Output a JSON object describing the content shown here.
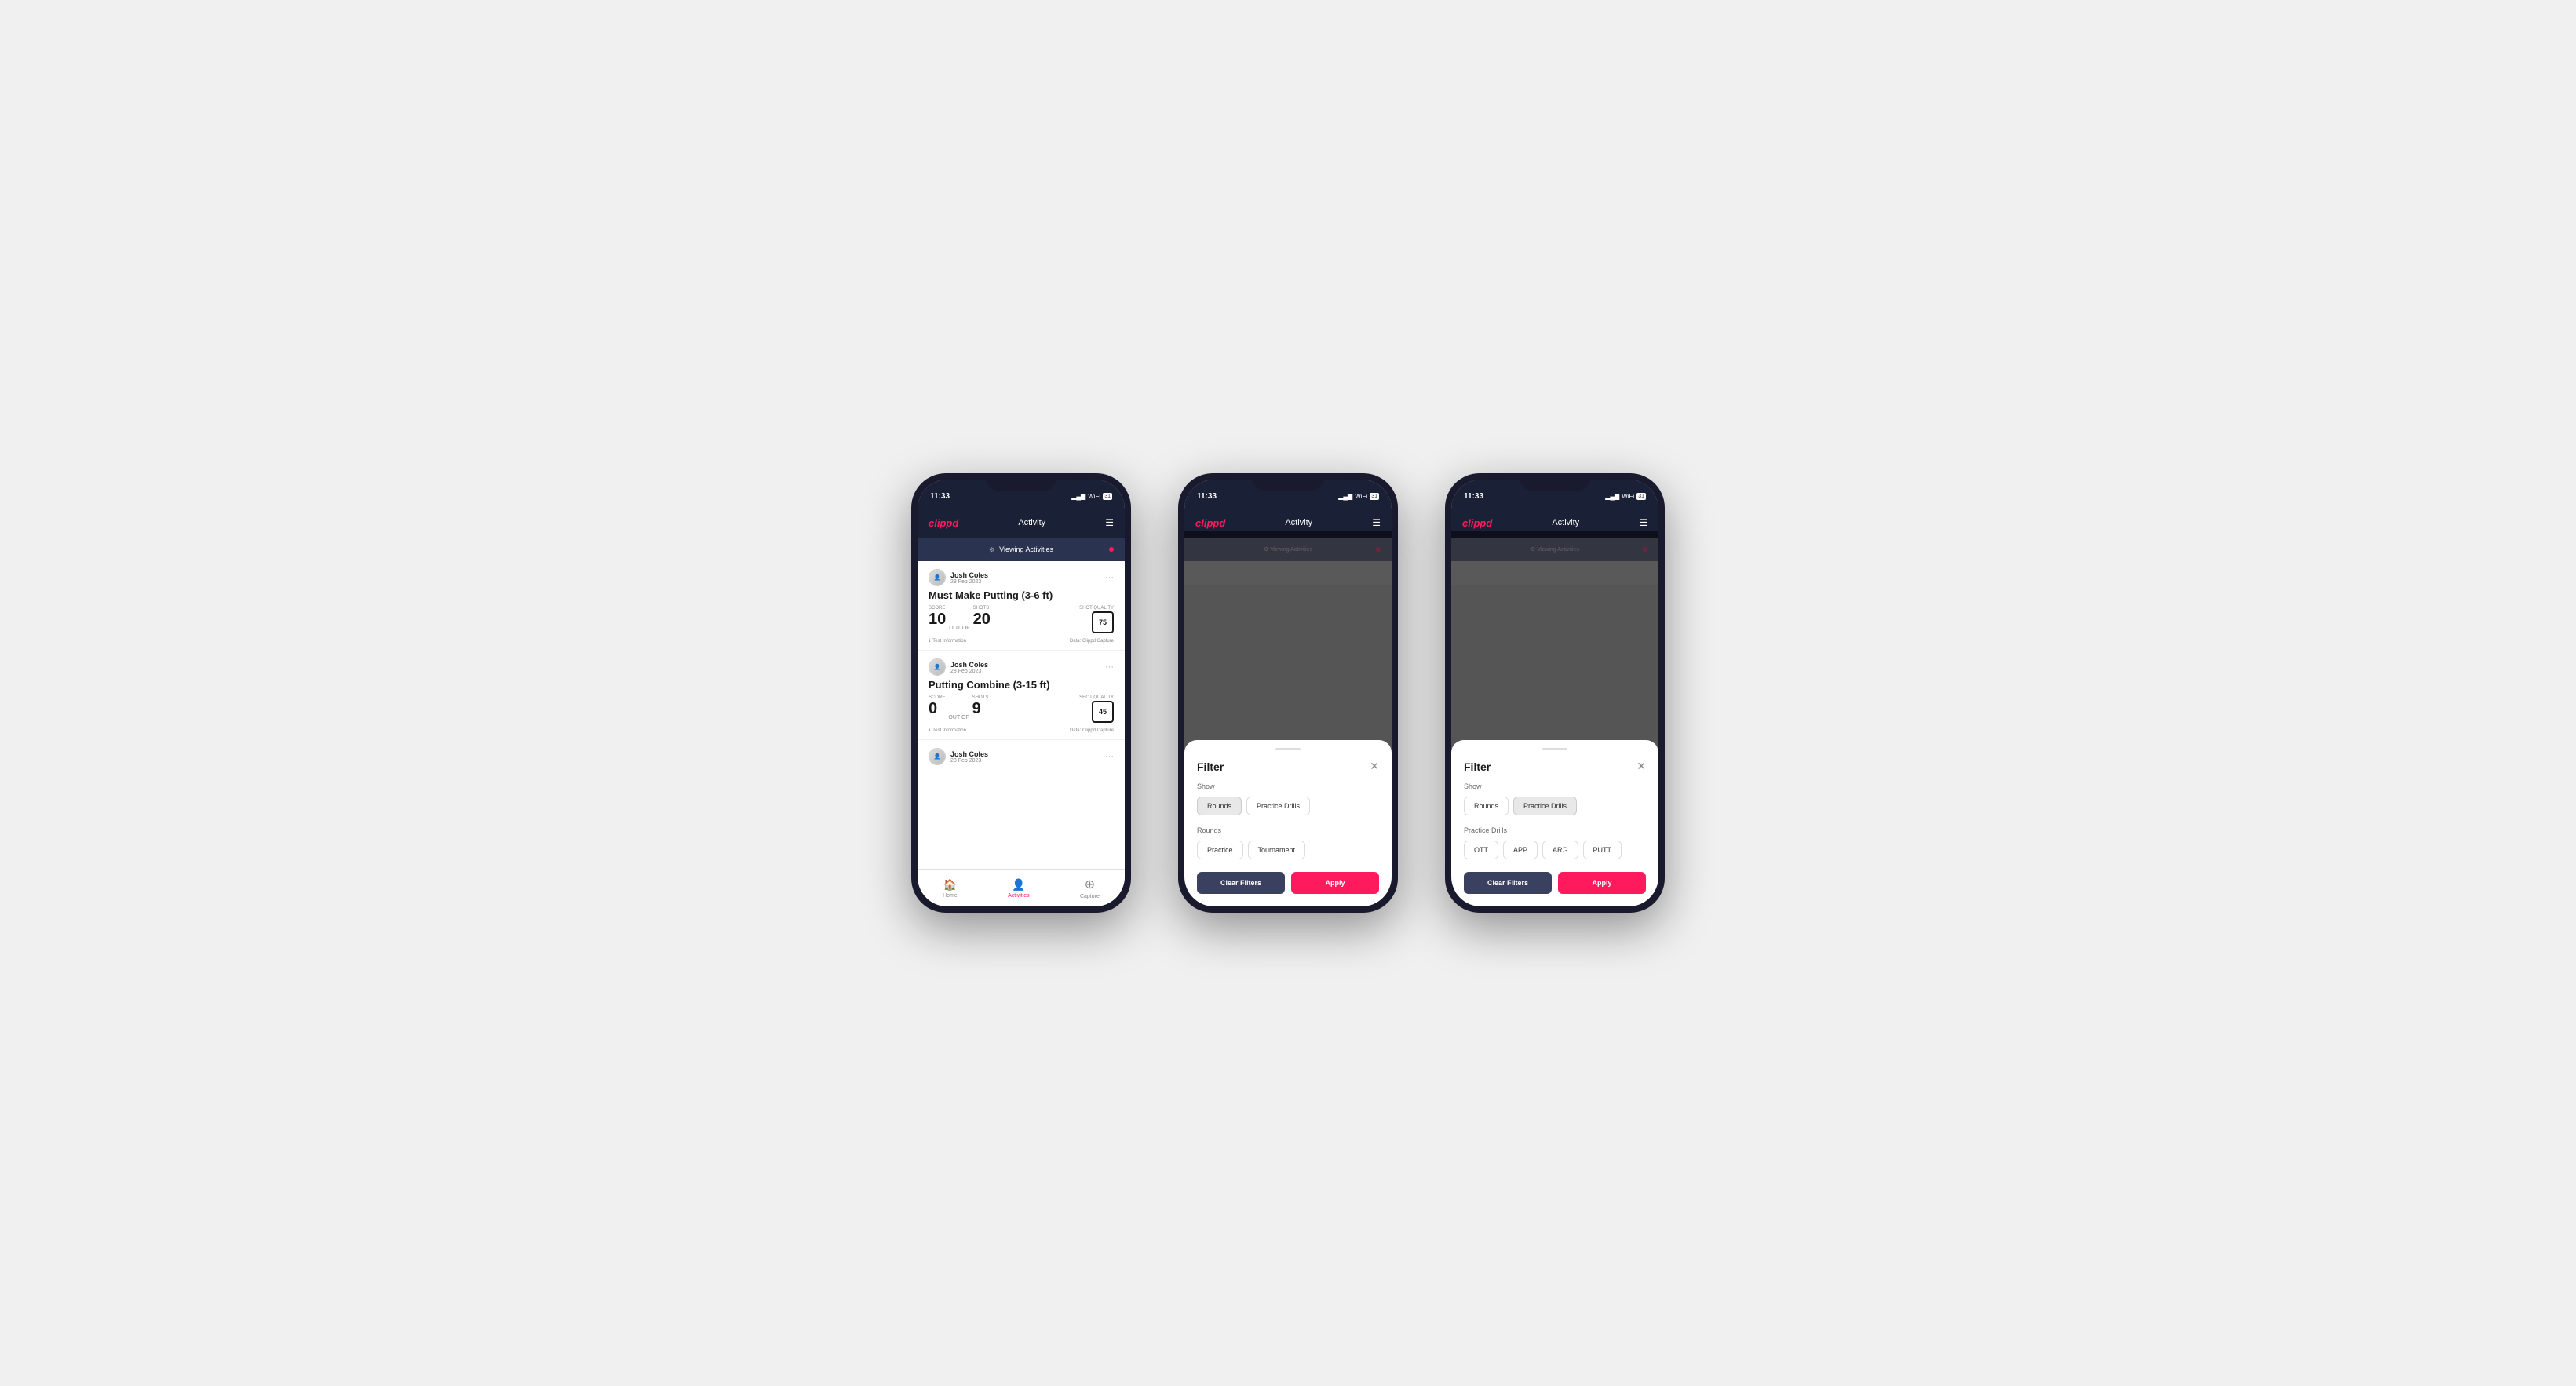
{
  "app": {
    "time": "11:33",
    "logo": "clippd",
    "header_title": "Activity",
    "viewing_bar_text": "Viewing Activities"
  },
  "phone1": {
    "cards": [
      {
        "user_name": "Josh Coles",
        "user_date": "28 Feb 2023",
        "title": "Must Make Putting (3-6 ft)",
        "score_label": "Score",
        "score": "10",
        "out_of_label": "OUT OF",
        "shots_label": "Shots",
        "shots": "20",
        "shot_quality_label": "Shot Quality",
        "shot_quality": "75",
        "info_text": "Test Information",
        "data_source": "Data: Clippd Capture"
      },
      {
        "user_name": "Josh Coles",
        "user_date": "28 Feb 2023",
        "title": "Putting Combine (3-15 ft)",
        "score_label": "Score",
        "score": "0",
        "out_of_label": "OUT OF",
        "shots_label": "Shots",
        "shots": "9",
        "shot_quality_label": "Shot Quality",
        "shot_quality": "45",
        "info_text": "Test Information",
        "data_source": "Data: Clippd Capture"
      },
      {
        "user_name": "Josh Coles",
        "user_date": "28 Feb 2023",
        "title": "",
        "score": "",
        "shots": "",
        "shot_quality": ""
      }
    ],
    "nav": [
      {
        "label": "Home",
        "icon": "🏠",
        "active": false
      },
      {
        "label": "Activities",
        "icon": "👤",
        "active": true
      },
      {
        "label": "Capture",
        "icon": "⊕",
        "active": false
      }
    ]
  },
  "phone2": {
    "filter": {
      "title": "Filter",
      "show_label": "Show",
      "rounds_label": "Rounds",
      "practice_drills_label": "Practice Drills",
      "rounds_section_label": "Rounds",
      "practice_btn": "Practice",
      "tournament_btn": "Tournament",
      "clear_filters_label": "Clear Filters",
      "apply_label": "Apply",
      "selected_tab": "Rounds"
    }
  },
  "phone3": {
    "filter": {
      "title": "Filter",
      "show_label": "Show",
      "rounds_label": "Rounds",
      "practice_drills_label": "Practice Drills",
      "practice_drills_section_label": "Practice Drills",
      "ott_label": "OTT",
      "app_label": "APP",
      "arg_label": "ARG",
      "putt_label": "PUTT",
      "clear_filters_label": "Clear Filters",
      "apply_label": "Apply",
      "selected_tab": "Practice Drills"
    }
  }
}
